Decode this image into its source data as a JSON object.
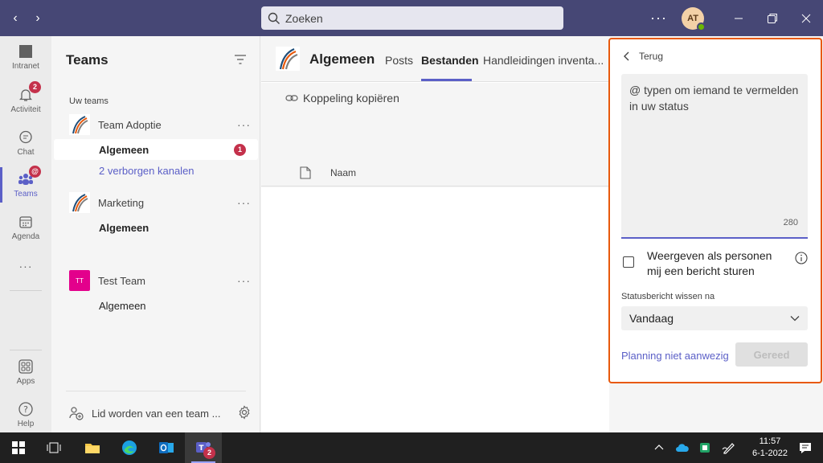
{
  "titlebar": {
    "search_placeholder": "Zoeken",
    "avatar_initials": "AT",
    "more_label": "···"
  },
  "rail": {
    "items": [
      {
        "label": "Intranet"
      },
      {
        "label": "Activiteit",
        "badge": "2"
      },
      {
        "label": "Chat"
      },
      {
        "label": "Teams",
        "badge": "@"
      },
      {
        "label": "Agenda"
      },
      {
        "label": "Apps"
      },
      {
        "label": "Help"
      }
    ]
  },
  "teams_panel": {
    "title": "Teams",
    "section_label": "Uw teams",
    "teams": [
      {
        "name": "Team Adoptie",
        "channel": "Algemeen",
        "channel_count": "1",
        "hidden": "2 verborgen kanalen"
      },
      {
        "name": "Marketing",
        "channel": "Algemeen"
      },
      {
        "name": "Test Team",
        "logo_initials": "TT",
        "channel": "Algemeen"
      }
    ],
    "join_label": "Lid worden van een team ..."
  },
  "channel": {
    "title": "Algemeen",
    "tabs": [
      "Posts",
      "Bestanden",
      "Handleidingen inventa..."
    ],
    "active_tab": "Bestanden",
    "copy_link": "Koppeling kopiëren",
    "column_name": "Naam"
  },
  "status_panel": {
    "back_label": "Terug",
    "placeholder": "@ typen om iemand te vermelden in uw status",
    "char_count": "280",
    "checkbox_label": "Weergeven als personen mij een bericht sturen",
    "clear_label": "Statusbericht wissen na",
    "clear_value": "Vandaag",
    "schedule_link": "Planning niet aanwezig",
    "done_label": "Gereed"
  },
  "taskbar": {
    "time": "11:57",
    "date": "6-1-2022",
    "teams_badge": "2"
  },
  "colors": {
    "titlebar": "#464775",
    "accent": "#5b5fc7",
    "highlight_border": "#e8590c",
    "badge": "#c4314b"
  }
}
